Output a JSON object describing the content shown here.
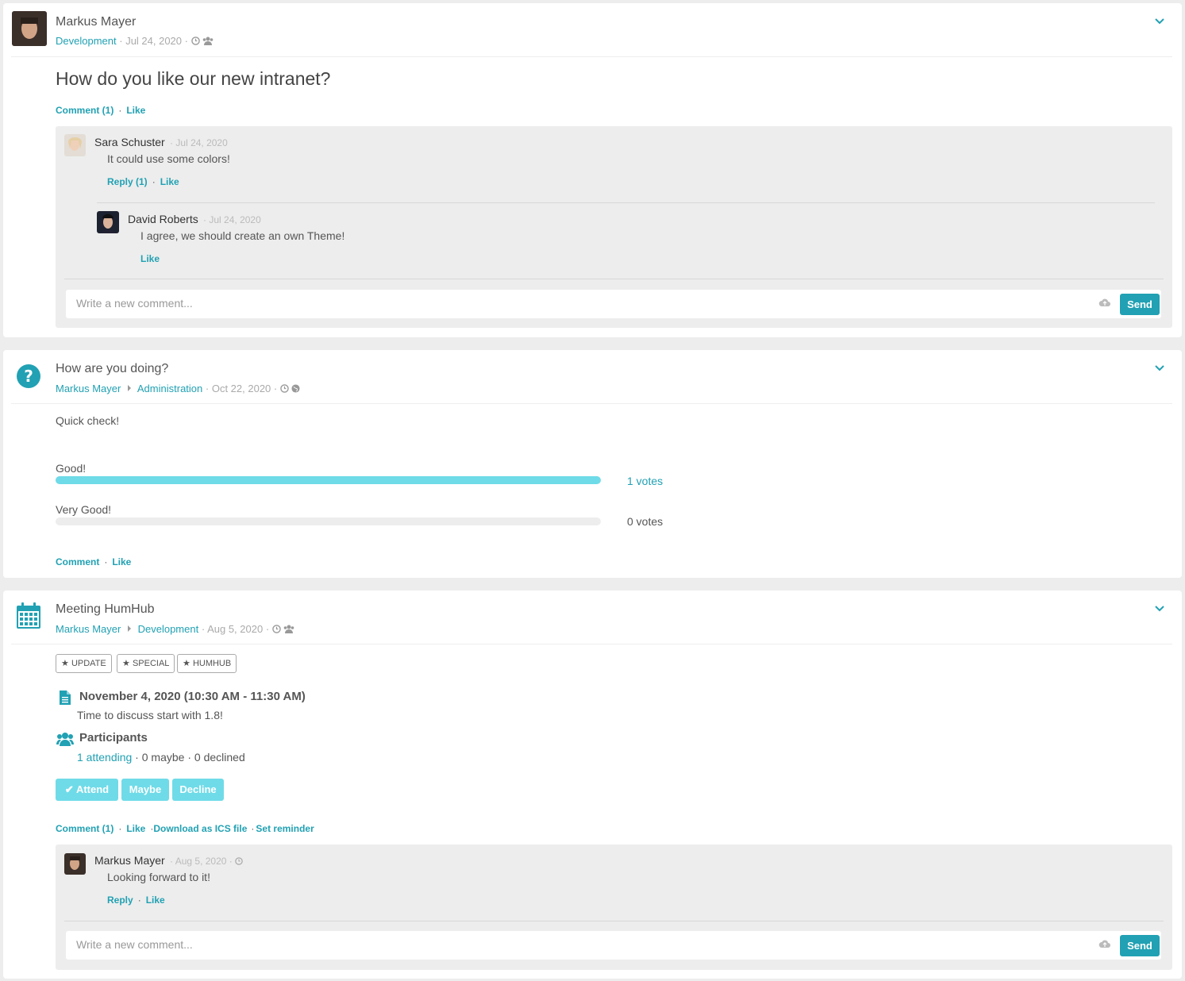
{
  "post1": {
    "author": "Markus Mayer",
    "space": "Development",
    "date": "Jul 24, 2020",
    "title": "How do you like our new intranet?",
    "actions": {
      "comment": "Comment (1)",
      "like": "Like"
    },
    "comments": [
      {
        "author": "Sara Schuster",
        "date": "Jul 24, 2020",
        "text": "It could use some colors!",
        "actions": {
          "reply": "Reply (1)",
          "like": "Like"
        },
        "replies": [
          {
            "author": "David Roberts",
            "date": "Jul 24, 2020",
            "text": "I agree, we should create an own Theme!",
            "actions": {
              "like": "Like"
            }
          }
        ]
      }
    ],
    "input": {
      "placeholder": "Write a new comment...",
      "send": "Send"
    }
  },
  "post2": {
    "title": "How are you doing?",
    "author": "Markus Mayer",
    "space": "Administration",
    "date": "Oct 22, 2020",
    "description": "Quick check!",
    "options": [
      {
        "label": "Good!",
        "votes_text": "1 votes",
        "fraction": 1.0
      },
      {
        "label": "Very Good!",
        "votes_text": "0 votes",
        "fraction": 0.0
      }
    ],
    "actions": {
      "comment": "Comment",
      "like": "Like"
    }
  },
  "post3": {
    "title": "Meeting HumHub",
    "author": "Markus Mayer",
    "space": "Development",
    "date": "Aug 5, 2020",
    "tags": [
      "UPDATE",
      "SPECIAL",
      "HUMHUB"
    ],
    "datetime": "November 4, 2020 (10:30 AM - 11:30 AM)",
    "description": "Time to discuss start with 1.8!",
    "participants_label": "Participants",
    "attending": "1 attending",
    "maybe": "0 maybe",
    "declined": "0 declined",
    "buttons": {
      "attend": "Attend",
      "maybe": "Maybe",
      "decline": "Decline"
    },
    "actions": {
      "comment": "Comment (1)",
      "like": "Like",
      "ics": "Download as ICS file",
      "reminder": "Set reminder"
    },
    "comments": [
      {
        "author": "Markus Mayer",
        "date": "Aug 5, 2020",
        "text": "Looking forward to it!",
        "actions": {
          "reply": "Reply",
          "like": "Like"
        }
      }
    ],
    "input": {
      "placeholder": "Write a new comment...",
      "send": "Send"
    }
  },
  "colors": {
    "accent": "#21a1b3",
    "poll_fill": "#6fdbe8",
    "event_button": "#6fdbe8",
    "background": "#ededed"
  },
  "icons": [
    "chevron-down-icon",
    "clock-icon",
    "users-icon",
    "globe-icon",
    "question-circle-icon",
    "calendar-icon",
    "file-icon",
    "cloud-upload-icon",
    "star-icon",
    "check-icon",
    "caret-right-icon"
  ]
}
